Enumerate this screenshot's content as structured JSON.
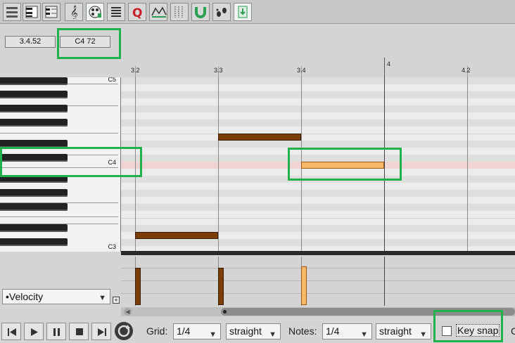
{
  "position": {
    "time": "3.4.52",
    "pitch_velocity": "C4  72"
  },
  "ruler": {
    "labels": [
      "3.2",
      "3.3",
      "3.4",
      "4",
      "4.2"
    ]
  },
  "keyboard": {
    "labels": [
      "C5",
      "C4",
      "C3"
    ]
  },
  "notes": [
    {
      "pitch": "C3",
      "start": "3.2",
      "end": "3.3",
      "selected": false
    },
    {
      "pitch": "F4",
      "start": "3.3",
      "end": "3.4",
      "selected": false
    },
    {
      "pitch": "C4",
      "start": "3.4",
      "end": "4",
      "selected": true
    }
  ],
  "lane": {
    "selected": "•Velocity",
    "add_label": "+"
  },
  "velocity_bars": [
    {
      "note": "C3",
      "selected": false
    },
    {
      "note": "F4",
      "selected": false
    },
    {
      "note": "C4",
      "selected": true
    }
  ],
  "bottom": {
    "grid_label": "Grid:",
    "grid_value": "1/4",
    "grid_mode": "straight",
    "notes_label": "Notes:",
    "notes_value": "1/4",
    "notes_mode": "straight",
    "key_snap_label": "Key snap",
    "key_snap_checked": false,
    "truncated": "C"
  },
  "toolbar": {
    "icons": [
      "editor-view-icon",
      "piano-roll-view-icon",
      "named-notes-view-icon",
      "treble-clef-icon",
      "color-palette-icon",
      "event-list-icon",
      "quantize-icon",
      "cc-curve-icon",
      "grid-lines-icon",
      "magnet-snap-icon",
      "step-input-icon",
      "midi-input-icon"
    ]
  },
  "colors": {
    "note": "#7a3d05",
    "note_selected": "#f5b866",
    "highlight": "#22b04b"
  }
}
